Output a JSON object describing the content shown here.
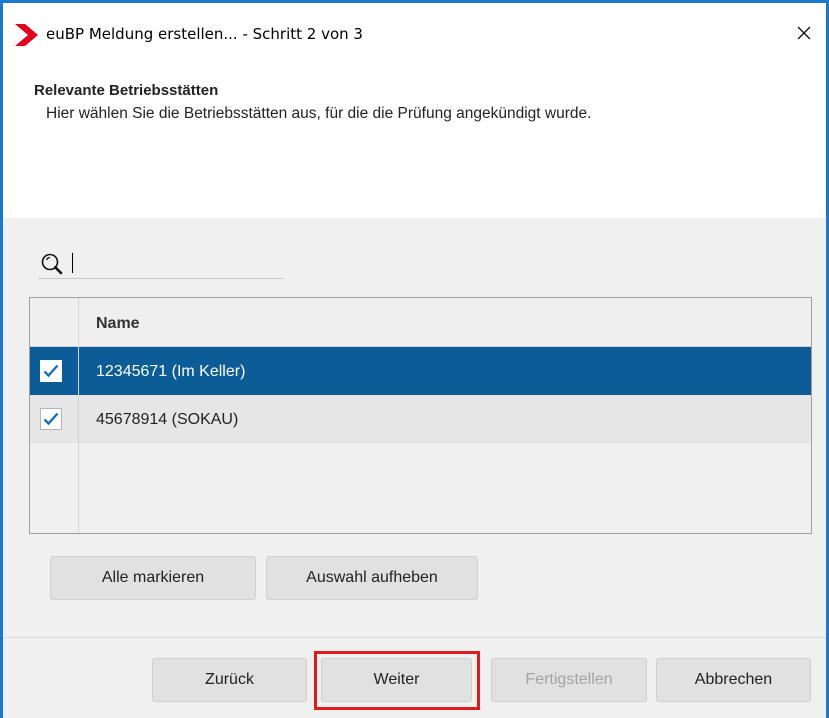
{
  "window": {
    "title": "euBP Meldung erstellen... - Schritt 2 von 3",
    "accent_color": "#1979ca",
    "logo_icon": "red-chevron-logo",
    "close_icon": "close-x"
  },
  "header": {
    "title": "Relevante Betriebsstätten",
    "description": "Hier wählen Sie die Betriebsstätten aus, für die die Prüfung angekündigt wurde."
  },
  "search": {
    "value": "",
    "placeholder": "",
    "icon": "magnifier"
  },
  "table": {
    "columns": [
      "",
      "Name"
    ],
    "rows": [
      {
        "checked": true,
        "selected": true,
        "name": "12345671 (Im Keller)"
      },
      {
        "checked": true,
        "selected": false,
        "name": "45678914 (SOKAU)"
      }
    ],
    "selection_color": "#0b5c97",
    "check_color": "#1b6fb8"
  },
  "selection_buttons": {
    "select_all": "Alle markieren",
    "deselect": "Auswahl aufheben"
  },
  "footer": {
    "back": "Zurück",
    "next": "Weiter",
    "finish": "Fertigstellen",
    "cancel": "Abbrechen",
    "finish_enabled": false,
    "highlight_color": "#e01b1b"
  }
}
